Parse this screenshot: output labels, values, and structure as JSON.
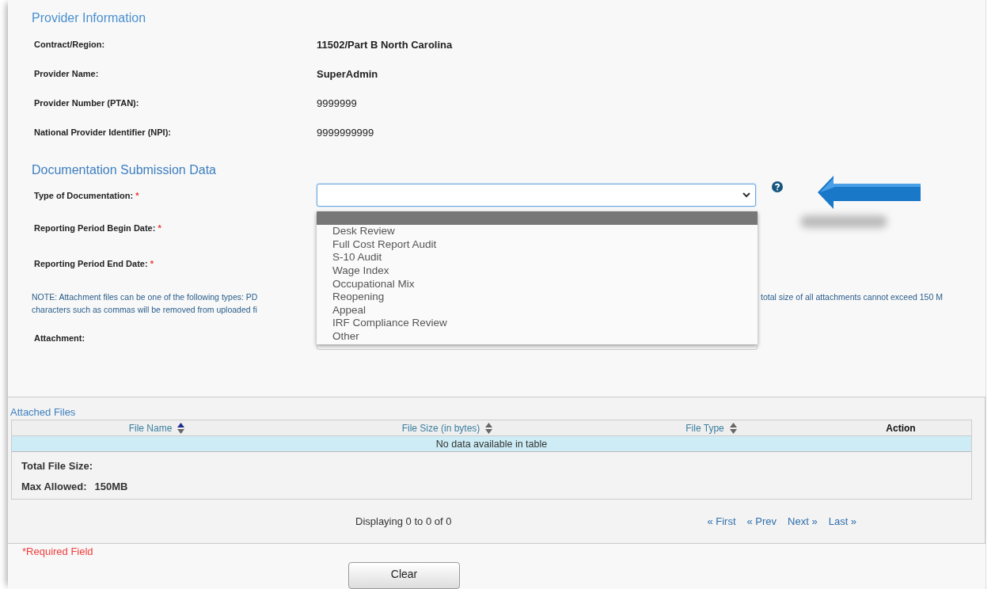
{
  "provider_section": {
    "title": "Provider Information",
    "fields": [
      {
        "label": "Contract/Region:",
        "value": "11502/Part B North Carolina",
        "bold": true
      },
      {
        "label": "Provider Name:",
        "value": "SuperAdmin",
        "bold": true
      },
      {
        "label": "Provider Number (PTAN):",
        "value": "9999999",
        "bold": false
      },
      {
        "label": "National Provider Identifier (NPI):",
        "value": "9999999999",
        "bold": false
      }
    ]
  },
  "documentation_section": {
    "title": "Documentation Submission Data",
    "type_of_documentation": {
      "label": "Type of Documentation:",
      "required_mark": "*",
      "expanded": true,
      "options": [
        {
          "selected": true
        },
        {
          "label": "Desk Review",
          "selected": false
        },
        {
          "label": "Full Cost Report Audit",
          "selected": false
        },
        {
          "label": "S-10 Audit",
          "selected": false
        },
        {
          "label": "Wage Index",
          "selected": false
        },
        {
          "label": "Occupational Mix",
          "selected": false
        },
        {
          "label": "Reopening",
          "selected": false
        },
        {
          "label": "Appeal",
          "selected": false
        },
        {
          "label": "IRF Compliance Review",
          "selected": false
        },
        {
          "label": "Other",
          "selected": false
        }
      ]
    },
    "begin_date": {
      "label": "Reporting Period Begin Date:",
      "required_mark": "*"
    },
    "end_date": {
      "label": "Reporting Period End Date:",
      "required_mark": "*"
    },
    "note": {
      "left_lines": [
        "NOTE: Attachment files can be one of the following types: PD",
        "characters such as commas will be removed from uploaded fi"
      ],
      "right": "total size of all attachments cannot exceed 150 M"
    },
    "attachment": {
      "label": "Attachment:"
    }
  },
  "attached_files": {
    "title": "Attached Files",
    "columns": [
      {
        "label": "File Name",
        "kind": "sortable",
        "sorted_ascending": true
      },
      {
        "label": "File Size (in bytes)",
        "kind": "sortable",
        "sorted_ascending": false
      },
      {
        "label": "File Type",
        "kind": "sortable",
        "sorted_ascending": false
      },
      {
        "label": "Action",
        "kind": "plain"
      }
    ],
    "empty_message": "No data available in table",
    "total_label": "Total File Size:",
    "max_label": "Max Allowed:",
    "max_value": "150MB",
    "pagination": {
      "summary": "Displaying 0 to 0 of 0",
      "links": [
        "« First",
        "« Prev",
        "Next »",
        "Last »"
      ]
    }
  },
  "required_note": "*Required Field",
  "buttons": [
    "Clear"
  ]
}
